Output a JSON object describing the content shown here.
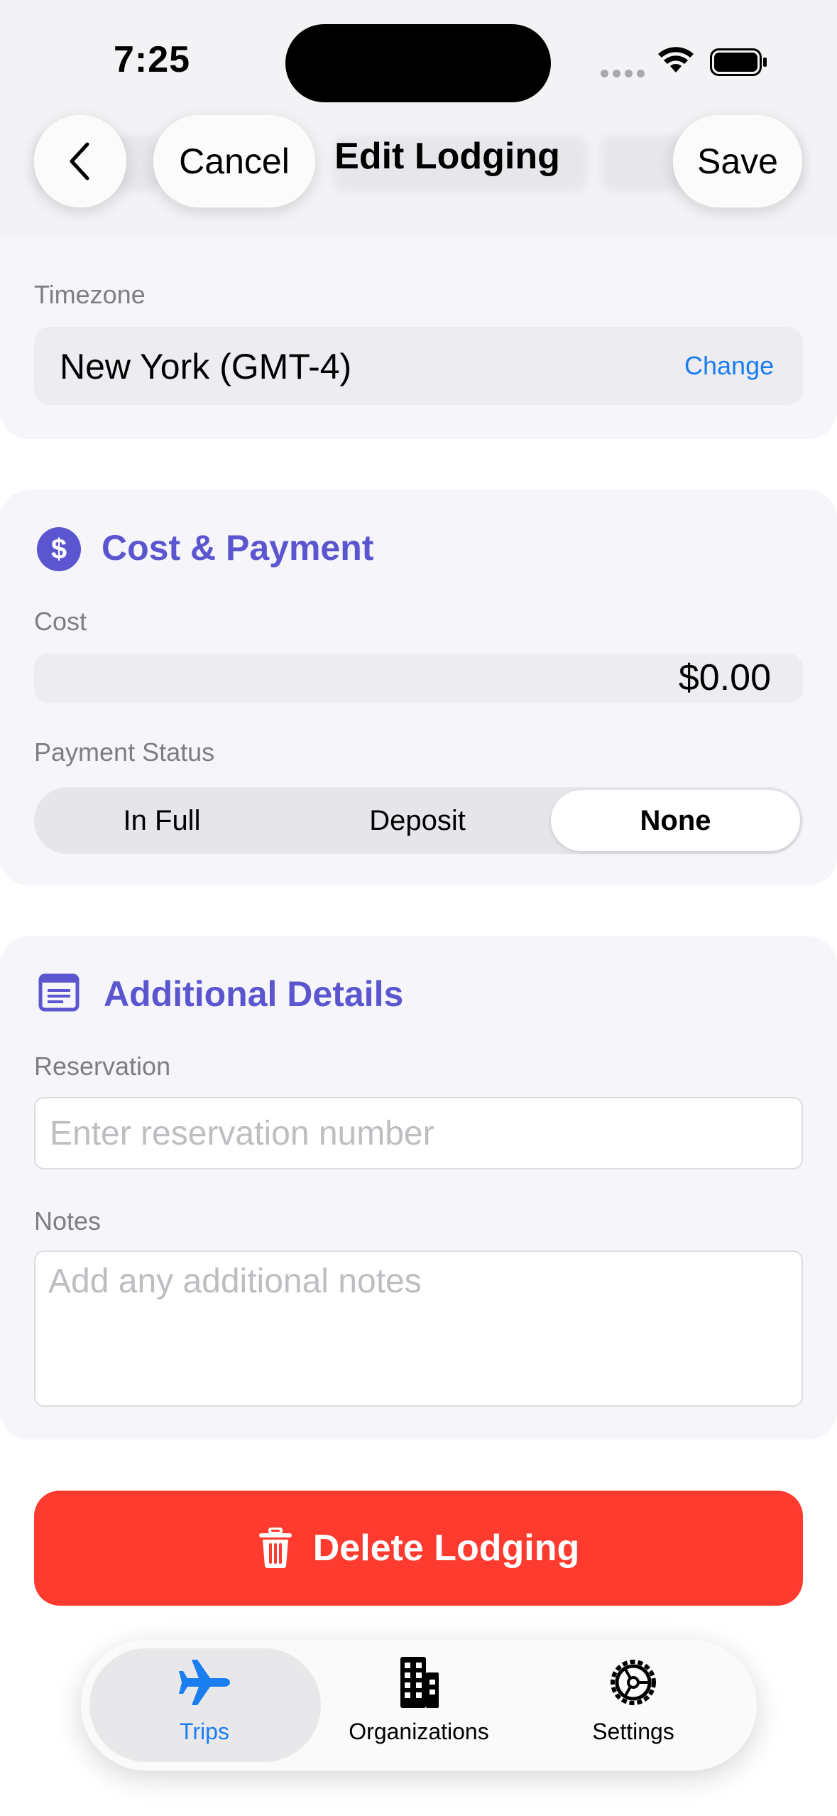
{
  "status_bar": {
    "time": "7:25"
  },
  "nav": {
    "back_icon": "chevron-left-icon",
    "cancel_label": "Cancel",
    "title": "Edit Lodging",
    "save_label": "Save"
  },
  "timezone": {
    "label": "Timezone",
    "value": "New York (GMT-4)",
    "change_label": "Change"
  },
  "cost_payment": {
    "icon": "dollar-circle-icon",
    "title": "Cost & Payment",
    "cost_label": "Cost",
    "cost_value": "$0.00",
    "payment_status_label": "Payment Status",
    "options": [
      "In Full",
      "Deposit",
      "None"
    ],
    "selected": "None"
  },
  "additional_details": {
    "icon": "document-icon",
    "title": "Additional Details",
    "reservation_label": "Reservation",
    "reservation_placeholder": "Enter reservation number",
    "notes_label": "Notes",
    "notes_placeholder": "Add any additional notes"
  },
  "delete_button": {
    "icon": "trash-icon",
    "label": "Delete Lodging"
  },
  "tabbar": {
    "items": [
      {
        "label": "Trips",
        "icon": "airplane-icon",
        "active": true
      },
      {
        "label": "Organizations",
        "icon": "building-icon",
        "active": false
      },
      {
        "label": "Settings",
        "icon": "gear-icon",
        "active": false
      }
    ]
  },
  "colors": {
    "accent": "#1a7ef0",
    "section_title": "#5b55cf",
    "delete": "#ff3b30",
    "card_bg": "#f5f5fa"
  }
}
